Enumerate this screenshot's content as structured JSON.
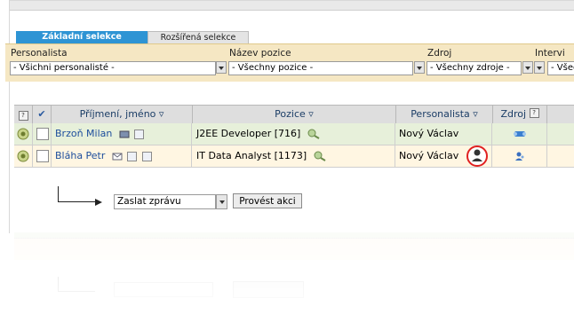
{
  "tabs": [
    {
      "label": "Základní selekce",
      "active": true
    },
    {
      "label": "Rozšířená selekce",
      "active": false
    }
  ],
  "filters": {
    "personalista": {
      "label": "Personalista",
      "value": "- Všichni personalisté -"
    },
    "pozice": {
      "label": "Název pozice",
      "value": "- Všechny pozice -"
    },
    "zdroj": {
      "label": "Zdroj",
      "value": "- Všechny zdroje -"
    },
    "interview": {
      "label": "Intervi",
      "value": "- Všec"
    }
  },
  "table": {
    "headers": {
      "help": "?",
      "check": "✔",
      "name": "Příjmení, jméno ▿",
      "position": "Pozice ▿",
      "recruiter": "Personalista ▿",
      "source": "Zdroj",
      "source_help": "?"
    },
    "rows": [
      {
        "name": "Brzoň Milan",
        "position": "J2EE Developer [716]",
        "recruiter": "Nový Václav"
      },
      {
        "name": "Bláha Petr",
        "position": "IT Data Analyst [1173]",
        "recruiter": "Nový Václav"
      }
    ]
  },
  "actions": {
    "select_value": "Zaslat zprávu",
    "button_label": "Provést akci"
  },
  "colors": {
    "tab_active": "#2e94d4",
    "filter_bg": "#f5e7c3",
    "row_selected_bg": "#e7f0da",
    "row_alt_bg": "#fff6e2",
    "highlight_circle": "#e02020"
  }
}
